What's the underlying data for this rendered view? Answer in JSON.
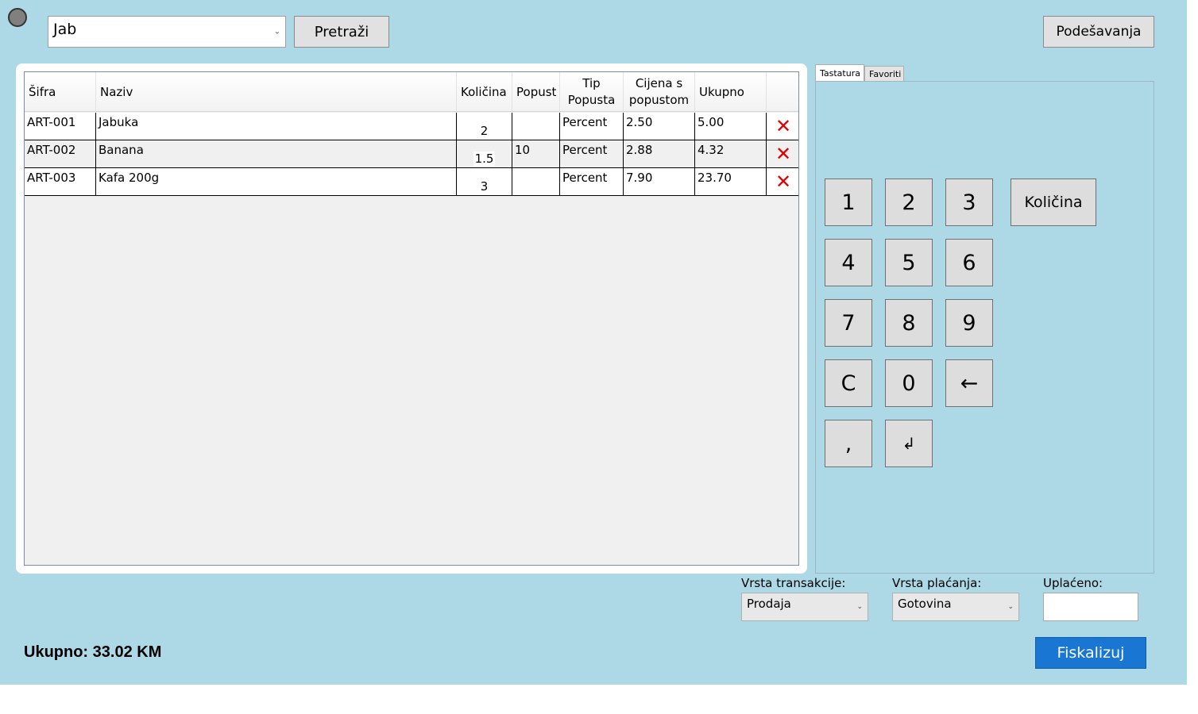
{
  "colors": {
    "background": "#add8e6",
    "accent": "#1976d2",
    "delete": "#e00000"
  },
  "search": {
    "value": "Jab",
    "button_label": "Pretraži"
  },
  "settings_label": "Podešavanja",
  "grid": {
    "headers": [
      "Šifra",
      "Naziv",
      "Količina",
      "Popust",
      "Tip Popusta",
      "Cijena s popustom",
      "Ukupno"
    ],
    "rows": [
      {
        "code": "ART-001",
        "name": "Jabuka",
        "qty": "2",
        "discount": "",
        "discount_type": "Percent",
        "price": "2.50",
        "total": "5.00"
      },
      {
        "code": "ART-002",
        "name": "Banana",
        "qty": "1.5",
        "discount": "10",
        "discount_type": "Percent",
        "price": "2.88",
        "total": "4.32"
      },
      {
        "code": "ART-003",
        "name": "Kafa 200g",
        "qty": "3",
        "discount": "",
        "discount_type": "Percent",
        "price": "7.90",
        "total": "23.70"
      }
    ],
    "delete_icon": "red-x-icon"
  },
  "tabs": [
    "Tastatura",
    "Favoriti"
  ],
  "keypad": {
    "keys": [
      "1",
      "2",
      "3",
      "4",
      "5",
      "6",
      "7",
      "8",
      "9",
      "C",
      "0",
      "←",
      ",",
      "↲"
    ],
    "quantity_label": "Količina"
  },
  "transaction": {
    "label": "Vrsta transakcije:",
    "value": "Prodaja"
  },
  "payment": {
    "label": "Vrsta plaćanja:",
    "value": "Gotovina"
  },
  "paid": {
    "label": "Uplaćeno:",
    "value": ""
  },
  "total_text": "Ukupno: 33.02 KM",
  "fiscalize_label": "Fiskalizuj"
}
